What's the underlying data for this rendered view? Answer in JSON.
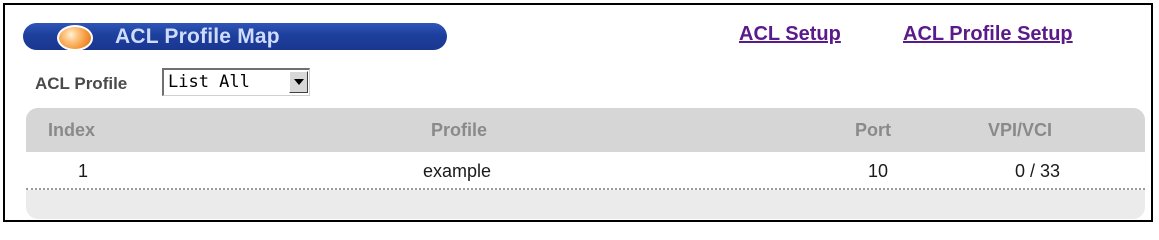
{
  "header": {
    "title": "ACL Profile Map",
    "links": [
      {
        "label": "ACL Setup"
      },
      {
        "label": "ACL Profile Setup"
      }
    ]
  },
  "filter": {
    "label": "ACL Profile",
    "selected": "List All"
  },
  "table": {
    "columns": [
      "Index",
      "Profile",
      "Port",
      "VPI/VCI"
    ],
    "rows": [
      {
        "index": "1",
        "profile": "example",
        "port": "10",
        "vpivci": "0 / 33"
      }
    ]
  },
  "colors": {
    "title_bar": "#1d3f9c",
    "title_text": "#cfdcff",
    "link": "#5a1a8a",
    "table_header_bg": "#d6d6d6",
    "table_header_text": "#8a8a8a"
  },
  "icons": {
    "title_orb": "orange-orb-icon",
    "dropdown": "chevron-down-icon"
  }
}
